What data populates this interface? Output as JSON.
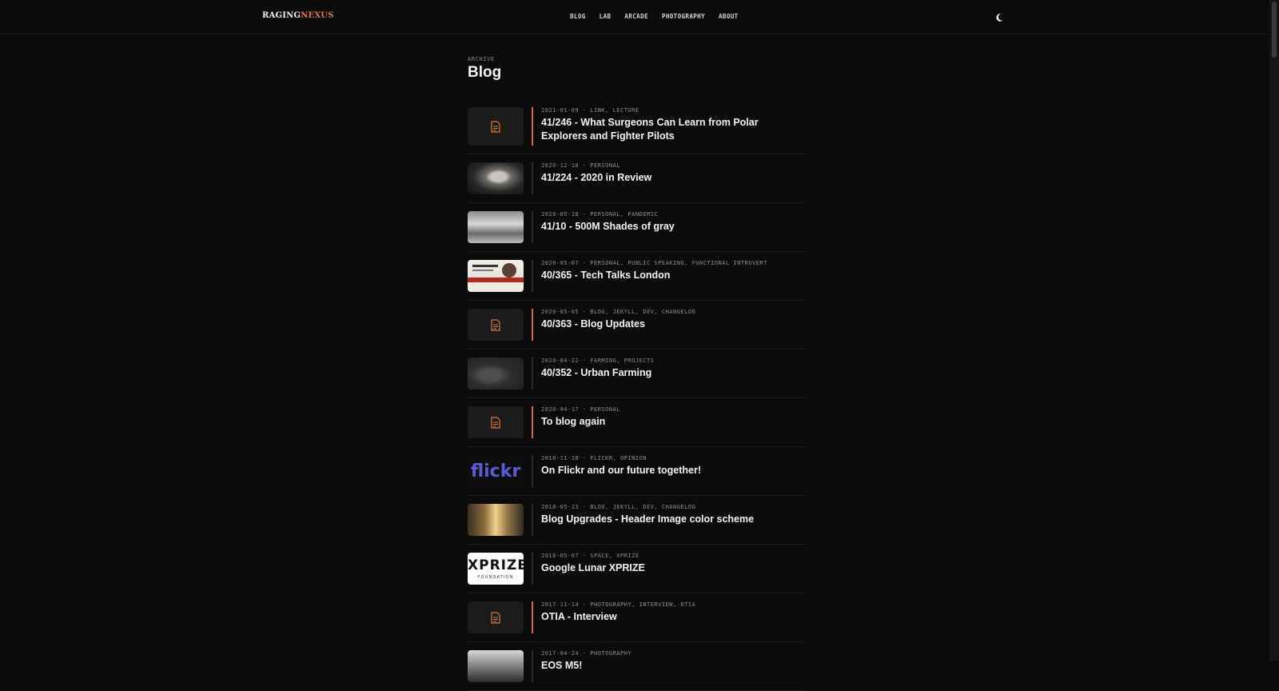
{
  "header": {
    "logo_part1": "RAGING",
    "logo_part2": "NEXUS",
    "nav": [
      "BLOG",
      "LAB",
      "ARCADE",
      "PHOTOGRAPHY",
      "ABOUT"
    ],
    "theme_toggle_icon": "moon-icon"
  },
  "page": {
    "eyebrow": "ARCHIVE",
    "title": "Blog"
  },
  "posts": [
    {
      "meta": "2021-01-09 · LINK, LECTURE",
      "title": "41/246 - What Surgeons Can Learn from Polar Explorers and Fighter Pilots",
      "thumb": "document-icon"
    },
    {
      "meta": "2020-12-18 · PERSONAL",
      "title": "41/224 - 2020 in Review",
      "thumb": "portrait-photo"
    },
    {
      "meta": "2020-05-18 · PERSONAL, PANDEMIC",
      "title": "41/10 - 500M Shades of gray",
      "thumb": "snow-photo"
    },
    {
      "meta": "2020-05-07 · PERSONAL, PUBLIC SPEAKING, FUNCTIONAL INTROVERT",
      "title": "40/365 - Tech Talks London",
      "thumb": "talk-poster"
    },
    {
      "meta": "2020-05-05 · BLOG, JEKYLL, DEV, CHANGELOG",
      "title": "40/363 - Blog Updates",
      "thumb": "document-icon"
    },
    {
      "meta": "2020-04-22 · FARMING, PROJECTS",
      "title": "40/352 - Urban Farming",
      "thumb": "farm-photo"
    },
    {
      "meta": "2020-04-17 · PERSONAL",
      "title": "To blog again",
      "thumb": "document-icon"
    },
    {
      "meta": "2018-11-18 · FLICKR, OPINION",
      "title": "On Flickr and our future together!",
      "thumb": "flickr-logo",
      "thumb_text": "flickr"
    },
    {
      "meta": "2018-05-13 · BLOG, JEKYLL, DEV, CHANGELOG",
      "title": "Blog Upgrades - Header Image color scheme",
      "thumb": "sunset-photo"
    },
    {
      "meta": "2018-05-07 · SPACE, XPRIZE",
      "title": "Google Lunar XPRIZE",
      "thumb": "xprize-logo",
      "thumb_text": "XPRIZE",
      "thumb_subtext": "FOUNDATION"
    },
    {
      "meta": "2017-11-14 · PHOTOGRAPHY, INTERVIEW, OTIA",
      "title": "OTIA - Interview",
      "thumb": "document-icon"
    },
    {
      "meta": "2017-04-24 · PHOTOGRAPHY",
      "title": "EOS M5!",
      "thumb": "camera-photo"
    }
  ],
  "colors": {
    "accent": "#d86a40",
    "background": "#0b0b0b"
  }
}
